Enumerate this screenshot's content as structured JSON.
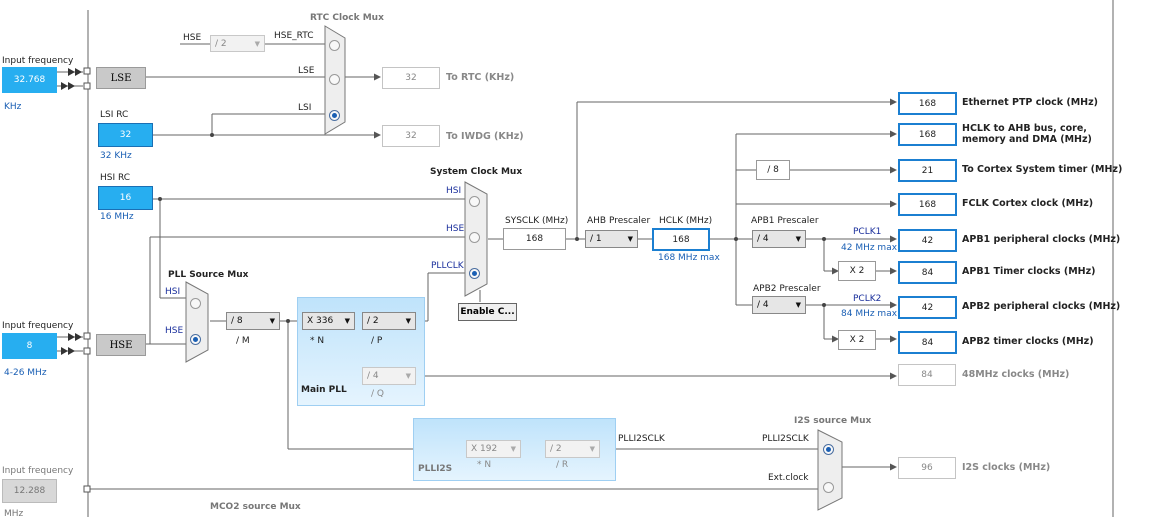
{
  "inputs": {
    "hse_in": {
      "caption": "Input frequency",
      "value": "32.768",
      "unit": "KHz"
    },
    "lsi": {
      "caption": "LSI RC",
      "value": "32",
      "unit": "32 KHz"
    },
    "hsi": {
      "caption": "HSI RC",
      "value": "16",
      "unit": "16 MHz"
    },
    "hse": {
      "caption": "Input frequency",
      "value": "8",
      "unit": "4-26 MHz"
    },
    "i2s": {
      "caption": "Input frequency",
      "value": "12.288",
      "unit": "MHz"
    }
  },
  "sources": {
    "lse": "LSE",
    "hse": "HSE"
  },
  "rtc": {
    "title": "RTC Clock Mux",
    "hse_label": "HSE",
    "div": "/ 2",
    "hse_rtc": "HSE_RTC",
    "lse_label": "LSE",
    "lsi_label": "LSI",
    "to_rtc_value": "32",
    "to_rtc_label": "To RTC (KHz)",
    "to_iwdg_value": "32",
    "to_iwdg_label": "To IWDG (KHz)"
  },
  "sysmux": {
    "title": "System Clock Mux",
    "hsi": "HSI",
    "hse": "HSE",
    "pllclk": "PLLCLK",
    "enable": "Enable C..."
  },
  "pllsrc": {
    "title": "PLL Source Mux",
    "hsi": "HSI",
    "hse": "HSE",
    "m_value": "/ 8",
    "m_label": "/ M"
  },
  "mainpll": {
    "title": "Main PLL",
    "n_value": "X 336",
    "n_label": "* N",
    "p_value": "/ 2",
    "p_label": "/ P",
    "q_value": "/ 4",
    "q_label": "/ Q"
  },
  "plli2s": {
    "title": "PLLI2S",
    "n_value": "X 192",
    "n_label": "* N",
    "r_value": "/ 2",
    "r_label": "/ R",
    "out_label": "PLLI2SCLK"
  },
  "i2smux": {
    "title": "I2S source Mux",
    "plli2sclk": "PLLI2SCLK",
    "ext": "Ext.clock",
    "value": "96",
    "out": "I2S clocks (MHz)"
  },
  "sysclk": {
    "label": "SYSCLK (MHz)",
    "value": "168"
  },
  "ahb": {
    "label": "AHB Prescaler",
    "value": "/ 1"
  },
  "hclk": {
    "label": "HCLK (MHz)",
    "value": "168",
    "max": "168 MHz max"
  },
  "apb1": {
    "label": "APB1 Prescaler",
    "value": "/ 4",
    "pclk": "PCLK1",
    "max": "42 MHz max",
    "x2": "X 2"
  },
  "apb2": {
    "label": "APB2 Prescaler",
    "value": "/ 4",
    "pclk": "PCLK2",
    "max": "84 MHz max",
    "x2": "X 2"
  },
  "cortex_div": "/ 8",
  "outputs": [
    {
      "value": "168",
      "label": "Ethernet PTP clock (MHz)"
    },
    {
      "value": "168",
      "label": "HCLK to AHB bus, core,",
      "label2": "memory and DMA (MHz)"
    },
    {
      "value": "21",
      "label": "To Cortex System timer (MHz)"
    },
    {
      "value": "168",
      "label": "FCLK Cortex clock (MHz)"
    },
    {
      "value": "42",
      "label": "APB1 peripheral clocks (MHz)"
    },
    {
      "value": "84",
      "label": "APB1 Timer clocks (MHz)"
    },
    {
      "value": "42",
      "label": "APB2 peripheral clocks (MHz)"
    },
    {
      "value": "84",
      "label": "APB2 timer clocks (MHz)"
    },
    {
      "value": "84",
      "label": "48MHz clocks (MHz)"
    }
  ],
  "mco2": {
    "title": "MCO2 source Mux"
  }
}
